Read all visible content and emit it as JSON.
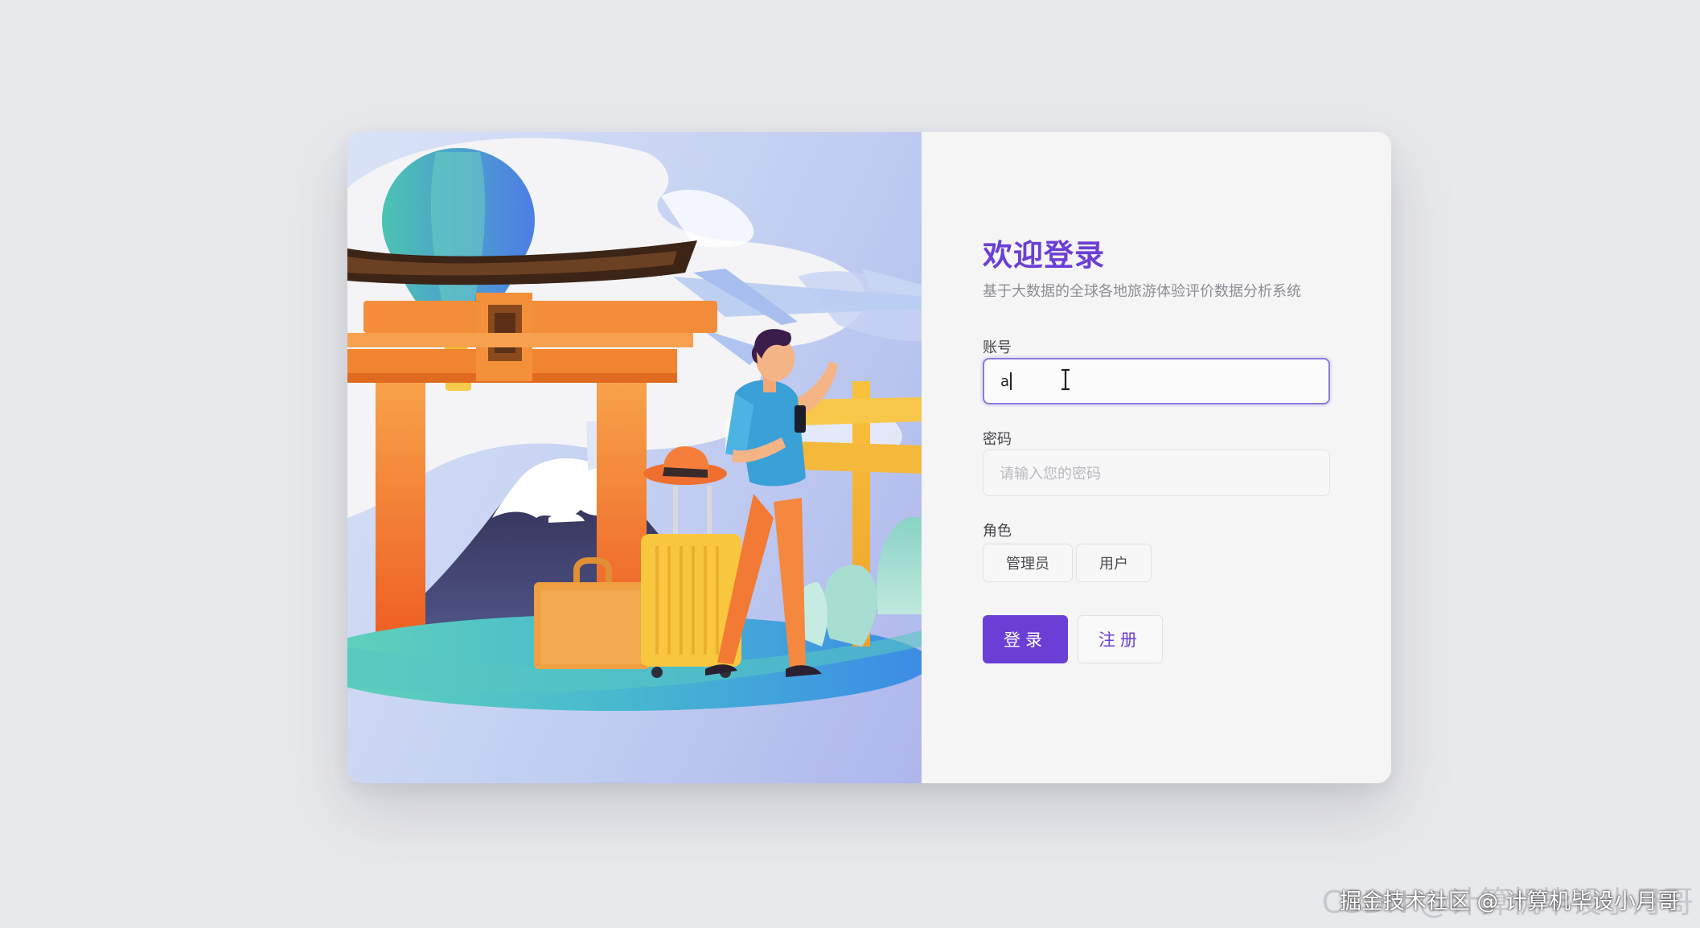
{
  "login": {
    "title": "欢迎登录",
    "subtitle": "基于大数据的全球各地旅游体验评价数据分析系统",
    "account": {
      "label": "账号",
      "value": "a"
    },
    "password": {
      "label": "密码",
      "placeholder": "请输入您的密码"
    },
    "role": {
      "label": "角色",
      "options": [
        "管理员",
        "用户"
      ]
    },
    "login_button": "登录",
    "register_button": "注册"
  },
  "illustration": {
    "icon": "travel-illustration"
  },
  "watermark": {
    "text": "掘金技术社区 @ 计算机毕设小月哥",
    "faint_text": "CSDN @计算机毕设小月哥"
  },
  "colors": {
    "accent": "#6b3fd6",
    "focus_border": "#8c77df",
    "background": "#e8e9ec"
  }
}
